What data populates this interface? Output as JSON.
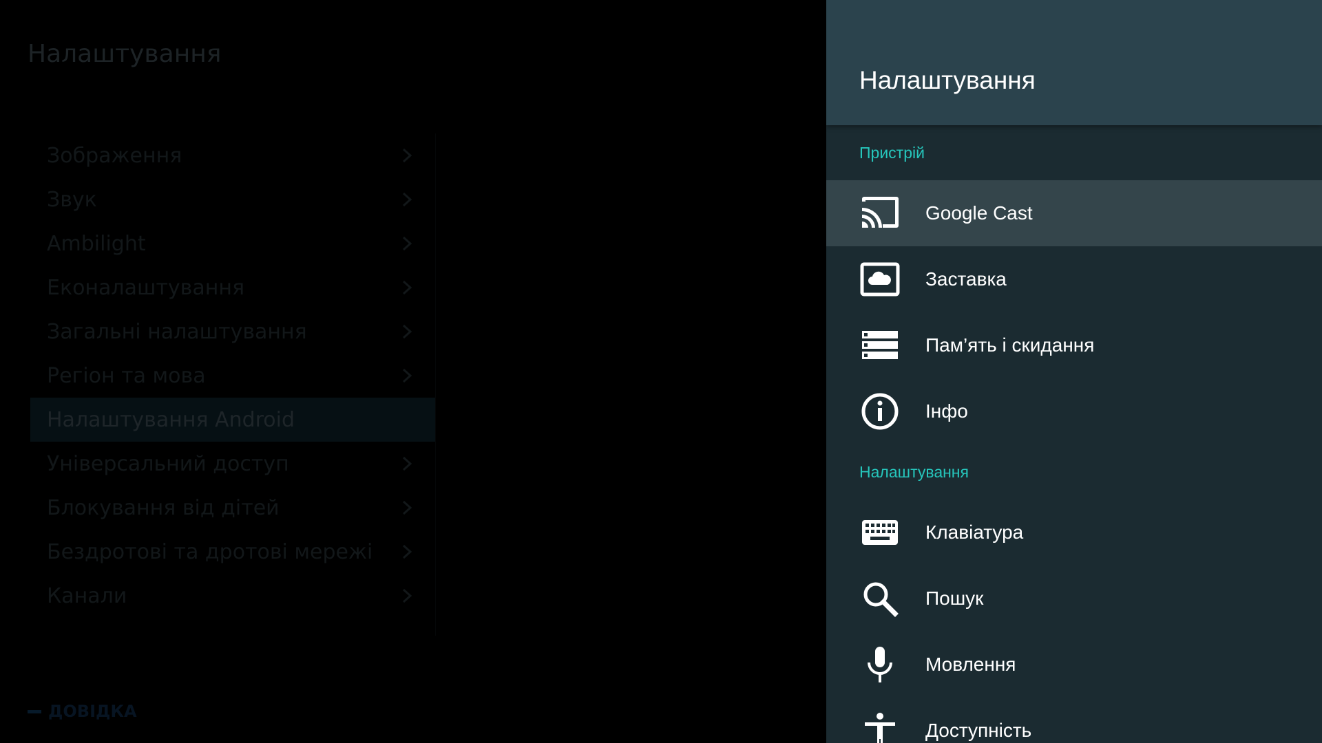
{
  "left_menu": {
    "title": "Налаштування",
    "items": [
      {
        "label": "Зображення"
      },
      {
        "label": "Звук"
      },
      {
        "label": "Ambilight"
      },
      {
        "label": "Еконалаштування"
      },
      {
        "label": "Загальні налаштування"
      },
      {
        "label": "Регіон та мова"
      },
      {
        "label": "Налаштування Android",
        "selected": true
      },
      {
        "label": "Універсальний доступ"
      },
      {
        "label": "Блокування від дітей"
      },
      {
        "label": "Бездротові та дротові мережі"
      },
      {
        "label": "Канали"
      }
    ],
    "help_label": "ДОВІДКА"
  },
  "panel": {
    "title": "Налаштування",
    "sections": [
      {
        "label": "Пристрій",
        "items": [
          {
            "label": "Google Cast",
            "icon": "cast-icon",
            "focused": true
          },
          {
            "label": "Заставка",
            "icon": "screensaver-icon"
          },
          {
            "label": "Пам’ять і скидання",
            "icon": "storage-icon"
          },
          {
            "label": "Інфо",
            "icon": "info-icon"
          }
        ]
      },
      {
        "label": "Налаштування",
        "items": [
          {
            "label": "Клавіатура",
            "icon": "keyboard-icon"
          },
          {
            "label": "Пошук",
            "icon": "search-icon"
          },
          {
            "label": "Мовлення",
            "icon": "microphone-icon"
          },
          {
            "label": "Доступність",
            "icon": "accessibility-icon"
          }
        ]
      }
    ]
  },
  "colors": {
    "panel_background": "#1b2b31",
    "panel_header": "#2b434d",
    "focused_row": "#34454b",
    "section_accent": "#26c6bc",
    "text": "#ffffff"
  }
}
